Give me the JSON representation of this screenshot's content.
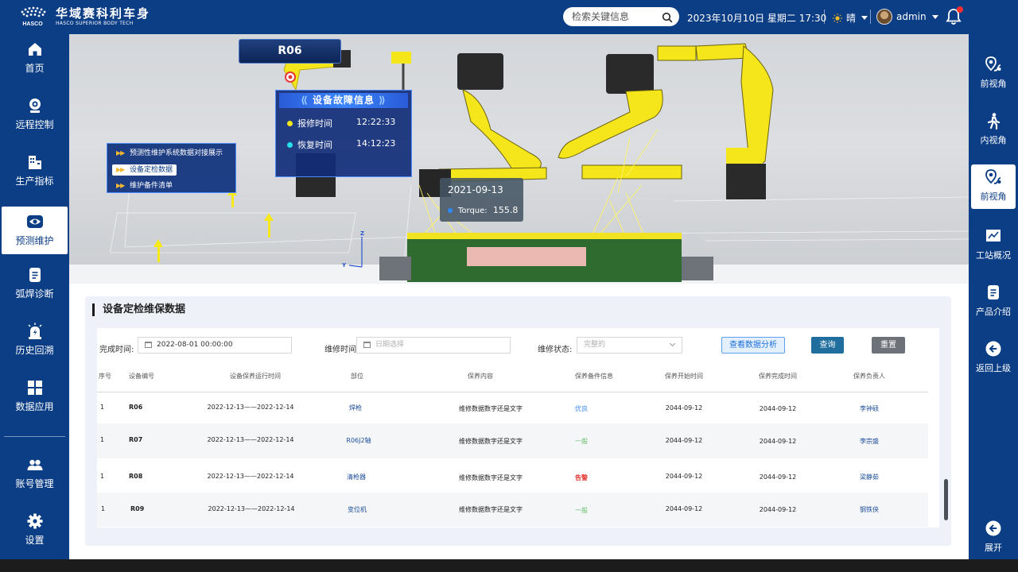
{
  "header": {
    "logo_cn": "华域赛科利车身",
    "logo_en": "HASCO SUPERIOR BODY TECH",
    "logo_mark_text": "HASCO",
    "search_placeholder": "检索关键信息",
    "datetime": "2023年10月10日  星期二  17:30",
    "weather": "晴",
    "user": "admin"
  },
  "sidebar": {
    "items": [
      {
        "label": "首页",
        "icon": "home-icon"
      },
      {
        "label": "远程控制",
        "icon": "webcam-icon"
      },
      {
        "label": "生产指标",
        "icon": "building-icon"
      },
      {
        "label": "预测维护",
        "icon": "eye-icon",
        "active": true
      },
      {
        "label": "弧焊诊断",
        "icon": "document-icon"
      },
      {
        "label": "历史回溯",
        "icon": "alarm-icon"
      },
      {
        "label": "数据应用",
        "icon": "grid-icon"
      },
      {
        "label": "账号管理",
        "icon": "users-icon"
      },
      {
        "label": "设置",
        "icon": "gear-icon"
      }
    ]
  },
  "right_sidebar": {
    "items": [
      {
        "label": "前视角",
        "icon": "location-pin-icon"
      },
      {
        "label": "内视角",
        "icon": "walking-person-icon"
      },
      {
        "label": "前视角",
        "icon": "location-pin-icon",
        "active": true
      },
      {
        "label": "工站概况",
        "icon": "line-chart-icon"
      },
      {
        "label": "产品介绍",
        "icon": "document-icon"
      },
      {
        "label": "返回上级",
        "icon": "back-arrow-icon"
      },
      {
        "label": "展开",
        "icon": "expand-arrow-icon"
      }
    ]
  },
  "viewport": {
    "robot_tag": "R06",
    "fault_panel": {
      "title": "设备故障信息",
      "repair_label": "报修时间",
      "repair_time": "12:22:33",
      "recover_label": "恢复时间",
      "recover_time": "14:12:23"
    },
    "pm_menu": [
      {
        "label": "预测性维护系统数据对接展示"
      },
      {
        "label": "设备定检数据",
        "active": true
      },
      {
        "label": "维护备件清单"
      }
    ],
    "tooltip": {
      "date": "2021-09-13",
      "metric_label": "Torque:",
      "metric_value": "155.8"
    },
    "axis_labels": {
      "z": "Z",
      "y": "Y"
    }
  },
  "panel": {
    "title": "设备定检维保数据",
    "filters": {
      "completion_time_label": "完成时间:",
      "completion_time_value": "2022-08-01 00:00:00",
      "maint_time_label": "维修时间:",
      "maint_time_placeholder": "日期选择",
      "maint_status_label": "维修状态:",
      "maint_status_placeholder": "完整的"
    },
    "buttons": {
      "analysis": "查看数据分析",
      "query": "查询",
      "reset": "重置"
    },
    "columns": [
      "序号",
      "设备编号",
      "设备保养运行时间",
      "部位",
      "保养内容",
      "保养备件信息",
      "保养开始时间",
      "保养完成时间",
      "保养负责人"
    ],
    "rows": [
      {
        "no": "1",
        "device": "R06",
        "run_time": "2022-12-13——2022-12-14",
        "part": "焊枪",
        "content": "维修数据数字还是文字",
        "spare": "优良",
        "spare_status": "good",
        "start": "2044-09-12",
        "end": "2044-09-12",
        "owner": "李钟硕"
      },
      {
        "no": "1",
        "device": "R07",
        "run_time": "2022-12-13——2022-12-14",
        "part": "R06J2轴",
        "content": "维修数据数字还是文字",
        "spare": "一般",
        "spare_status": "normal",
        "start": "2044-09-12",
        "end": "2044-09-12",
        "owner": "李宗盛"
      },
      {
        "no": "1",
        "device": "R08",
        "run_time": "2022-12-13——2022-12-14",
        "part": "清枪器",
        "content": "维修数据数字还是文字",
        "spare": "告警",
        "spare_status": "alarm",
        "start": "2044-09-12",
        "end": "2044-09-12",
        "owner": "梁静茹"
      },
      {
        "no": "1",
        "device": "R09",
        "run_time": "2022-12-13——2022-12-14",
        "part": "变位机",
        "content": "维修数据数字还是文字",
        "spare": "一般",
        "spare_status": "normal",
        "start": "2044-09-12",
        "end": "2044-09-12",
        "owner": "钢铁侠"
      }
    ]
  },
  "colors": {
    "brand": "#0c3e86",
    "accent": "#4e8bff",
    "robot": "#f5e61b",
    "alarm": "#e53935",
    "good": "#3e8cf5",
    "normal": "#6bbf6b"
  }
}
